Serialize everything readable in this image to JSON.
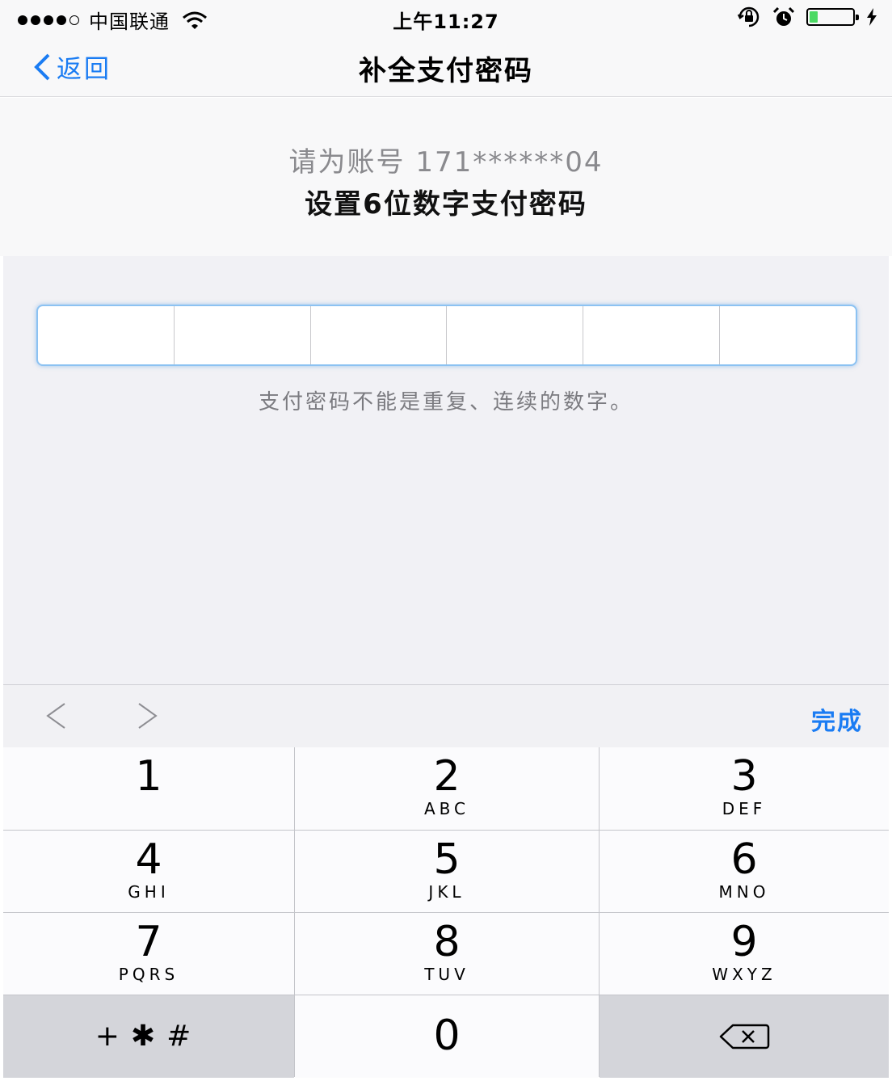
{
  "status_bar": {
    "signal_icon": "signal-dots-icon",
    "carrier": "中国联通",
    "wifi_icon": "wifi-icon",
    "time": "上午11:27",
    "icons": [
      "rotation-lock-icon",
      "alarm-icon",
      "battery-icon",
      "charging-icon"
    ],
    "battery_level": 0.2,
    "battery_color": "#4cd964"
  },
  "nav": {
    "back_icon": "chevron-left-icon",
    "back_label": "返回",
    "title": "补全支付密码",
    "accent_color": "#1a7cf3"
  },
  "prompt": {
    "line1": "请为账号 171******04",
    "line2": "设置6位数字支付密码"
  },
  "pin": {
    "length": 6,
    "hint": "支付密码不能是重复、连续的数字。"
  },
  "toolbar": {
    "prev_icon": "chevron-left-icon",
    "next_icon": "chevron-right-icon",
    "done_label": "完成"
  },
  "keypad": {
    "keys": [
      {
        "num": "1",
        "letters": ""
      },
      {
        "num": "2",
        "letters": "ABC"
      },
      {
        "num": "3",
        "letters": "DEF"
      },
      {
        "num": "4",
        "letters": "GHI"
      },
      {
        "num": "5",
        "letters": "JKL"
      },
      {
        "num": "6",
        "letters": "MNO"
      },
      {
        "num": "7",
        "letters": "PQRS"
      },
      {
        "num": "8",
        "letters": "TUV"
      },
      {
        "num": "9",
        "letters": "WXYZ"
      }
    ],
    "symbols": "+✱#",
    "zero": "0",
    "delete_icon": "backspace-icon"
  }
}
